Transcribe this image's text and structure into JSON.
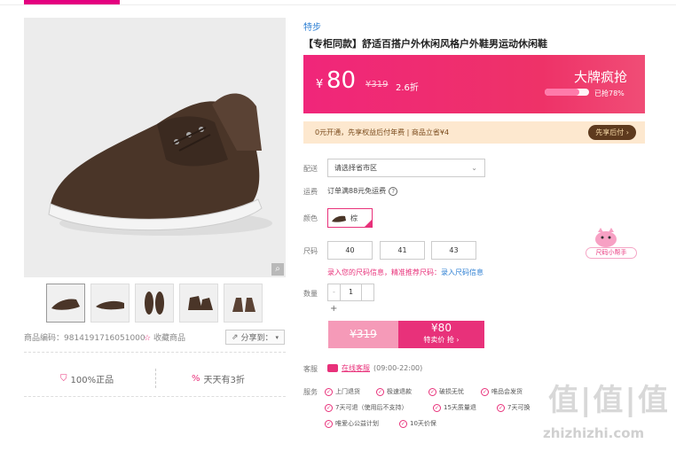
{
  "product": {
    "brand": "特步",
    "title": "【专柜同款】舒适百搭户外休闲风格户外鞋男运动休闲鞋",
    "code_label": "商品编码：",
    "code": "9814191716051000",
    "favorite_label": "收藏商品",
    "share_label": "分享到："
  },
  "price": {
    "currency": "¥",
    "current": "80",
    "original": "¥319",
    "discount": "2.6折",
    "flash_label": "大牌疯抢",
    "sold_label": "已抢78%",
    "sold_fraction": 0.78
  },
  "promo": {
    "text": "0元开通，先享权益后付年费 | 商品立省¥4",
    "button": "先享后付"
  },
  "delivery": {
    "label": "配送",
    "placeholder": "请选择省市区"
  },
  "shipping": {
    "label": "运费",
    "text": "订单满88元免运费"
  },
  "color": {
    "label": "颜色",
    "option": "棕"
  },
  "size": {
    "label": "尺码",
    "options": [
      "40",
      "41",
      "43"
    ],
    "hint": "录入您的尺码信息，精准推荐尺码：",
    "hint_link": "录入尺码信息",
    "helper": "尺码小帮手"
  },
  "quantity": {
    "label": "数量",
    "value": "1",
    "minus": "-",
    "plus": "+"
  },
  "buy": {
    "original": "¥319",
    "price": "¥80",
    "label": "特卖价 抢"
  },
  "service": {
    "label": "客服",
    "link": "在线客服",
    "hours": "(09:00-22:00)"
  },
  "guarantees": {
    "label": "服务",
    "items": [
      "上门退货",
      "极速退款",
      "破损无忧",
      "唯品会发货",
      "7天可退（使用后不支持）",
      "15天质量退",
      "7天可换",
      "唯爱心公益计划",
      "10天价保"
    ]
  },
  "promises": [
    "100%正品",
    "天天有3折"
  ],
  "watermark": {
    "logo": "值|值|值",
    "site": "zhizhizhi.com"
  }
}
